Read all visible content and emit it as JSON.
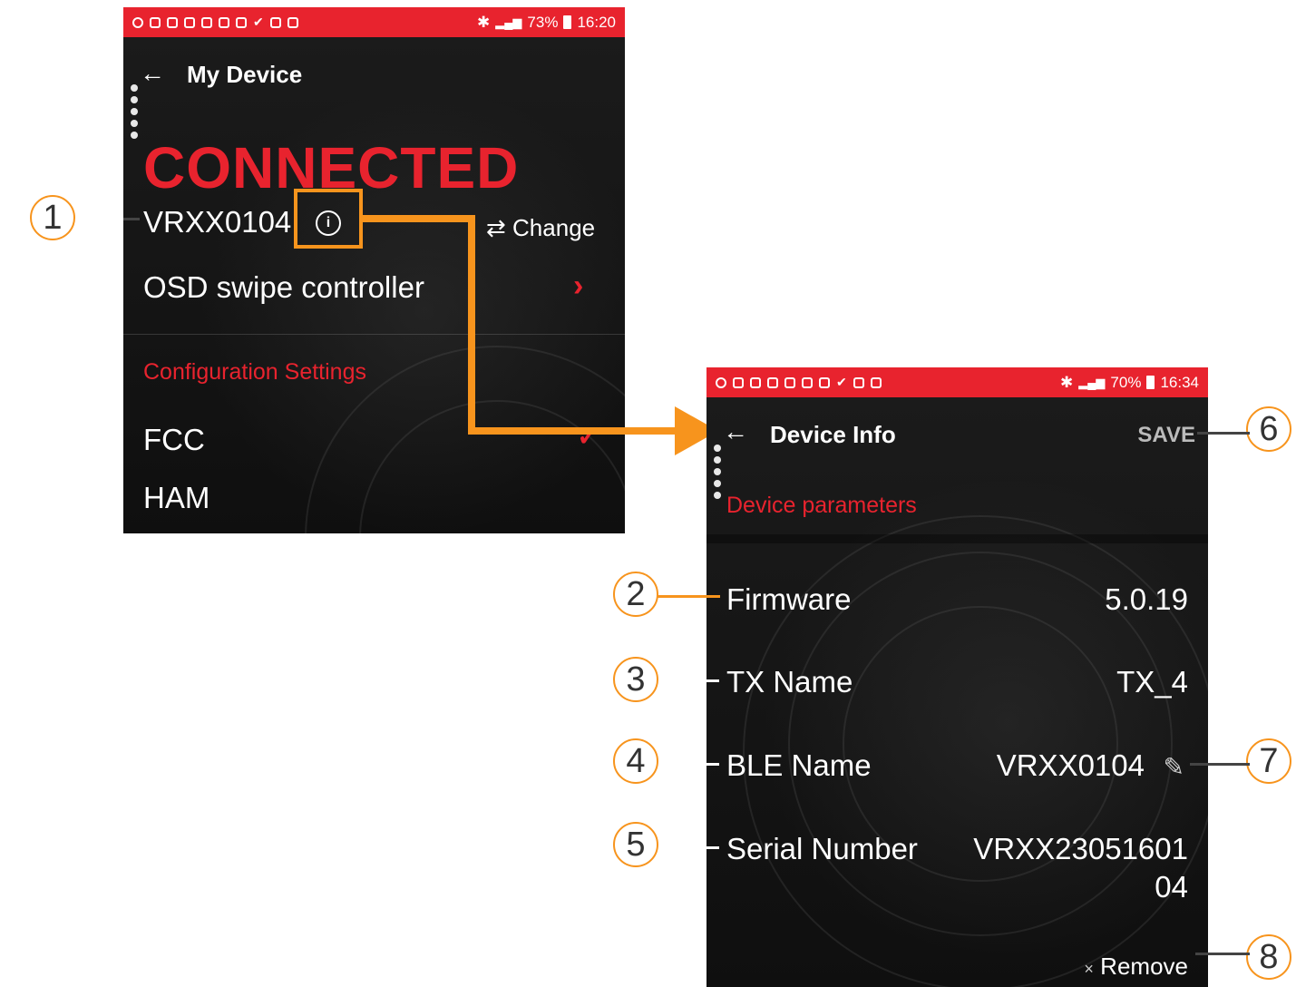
{
  "screen1": {
    "status": {
      "battery": "73%",
      "time": "16:20"
    },
    "title": "My Device",
    "state": "CONNECTED",
    "device_name": "VRXX0104",
    "change_label": "Change",
    "osd_label": "OSD swipe controller",
    "section_label": "Configuration Settings",
    "options": [
      "FCC",
      "HAM"
    ]
  },
  "screen2": {
    "status": {
      "battery": "70%",
      "time": "16:34"
    },
    "title": "Device Info",
    "save_label": "SAVE",
    "section_label": "Device parameters",
    "fields": [
      {
        "label": "Firmware",
        "value": "5.0.19"
      },
      {
        "label": "TX Name",
        "value": "TX_4"
      },
      {
        "label": "BLE Name",
        "value": "VRXX0104"
      },
      {
        "label": "Serial Number",
        "value_line1": "VRXX23051601",
        "value_line2": "04"
      }
    ],
    "remove_label": "Remove"
  },
  "callouts": [
    "1",
    "2",
    "3",
    "4",
    "5",
    "6",
    "7",
    "8"
  ],
  "colors": {
    "accent": "#e8232e",
    "highlight": "#f7941d",
    "background": "#141414"
  },
  "icons": [
    "back-arrow-icon",
    "info-icon",
    "swap-icon",
    "chevron-right-icon",
    "check-icon",
    "pencil-icon",
    "close-icon"
  ]
}
